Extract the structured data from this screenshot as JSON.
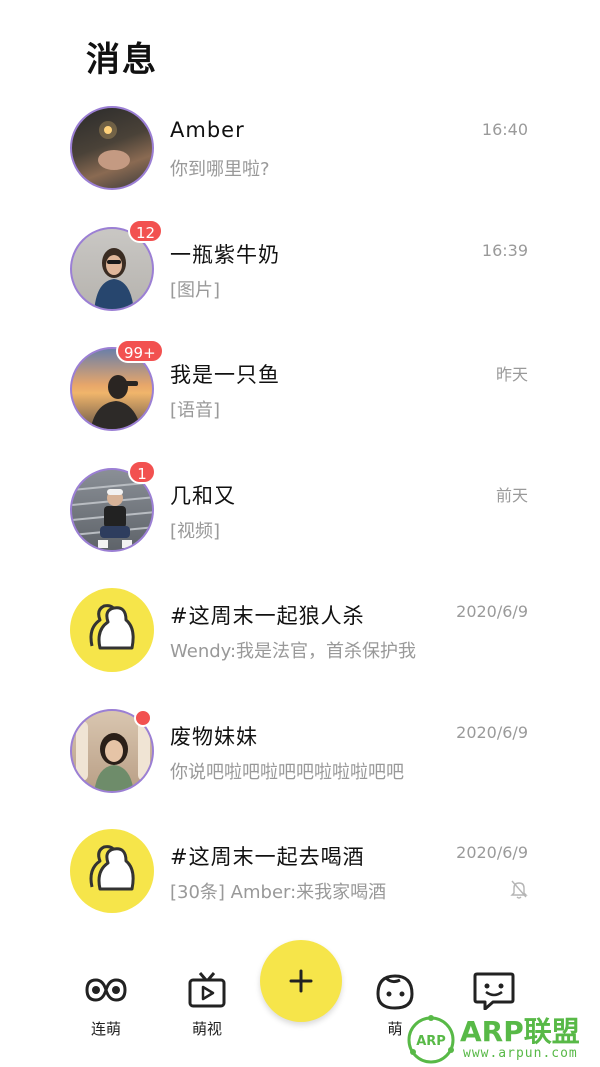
{
  "header": {
    "title": "消息"
  },
  "conversations": [
    {
      "name": "Amber",
      "preview": "你到哪里啦?",
      "time": "16:40",
      "badge": "",
      "avatar": "person-avatar",
      "muted": false
    },
    {
      "name": "一瓶紫牛奶",
      "preview": "[图片]",
      "time": "16:39",
      "badge": "12",
      "avatar": "person-avatar",
      "muted": false
    },
    {
      "name": "我是一只鱼",
      "preview": "[语音]",
      "time": "昨天",
      "badge": "99+",
      "avatar": "person-avatar",
      "muted": false
    },
    {
      "name": "几和又",
      "preview": "[视频]",
      "time": "前天",
      "badge": "1",
      "avatar": "person-avatar",
      "muted": false
    },
    {
      "name": "#这周末一起狼人杀",
      "preview": "Wendy:我是法官，首杀保护我",
      "time": "2020/6/9",
      "badge": "",
      "avatar": "group-icon",
      "muted": false
    },
    {
      "name": "废物妹妹",
      "preview": "你说吧啦吧啦吧吧啦啦啦吧吧",
      "time": "2020/6/9",
      "badge": "dot",
      "avatar": "person-avatar",
      "muted": false
    },
    {
      "name": "#这周末一起去喝酒",
      "preview": "[30条] Amber:来我家喝酒",
      "time": "2020/6/9",
      "badge": "",
      "avatar": "group-icon",
      "muted": true
    }
  ],
  "tabbar": {
    "tabs": [
      {
        "label": "连萌",
        "icon": "infinity-eyes-icon"
      },
      {
        "label": "萌视",
        "icon": "tv-icon"
      },
      {
        "label": "萌",
        "icon": "baby-face-icon"
      },
      {
        "label": "",
        "icon": "chat-face-icon"
      }
    ],
    "fab_icon": "plus-icon"
  },
  "watermark": {
    "text": "ARP联盟",
    "url": "www.arpun.com",
    "badge": "ARP"
  },
  "colors": {
    "accent": "#f6e54a",
    "badge": "#f25150",
    "ring": "#9b7fd4",
    "watermark": "#58b947"
  }
}
